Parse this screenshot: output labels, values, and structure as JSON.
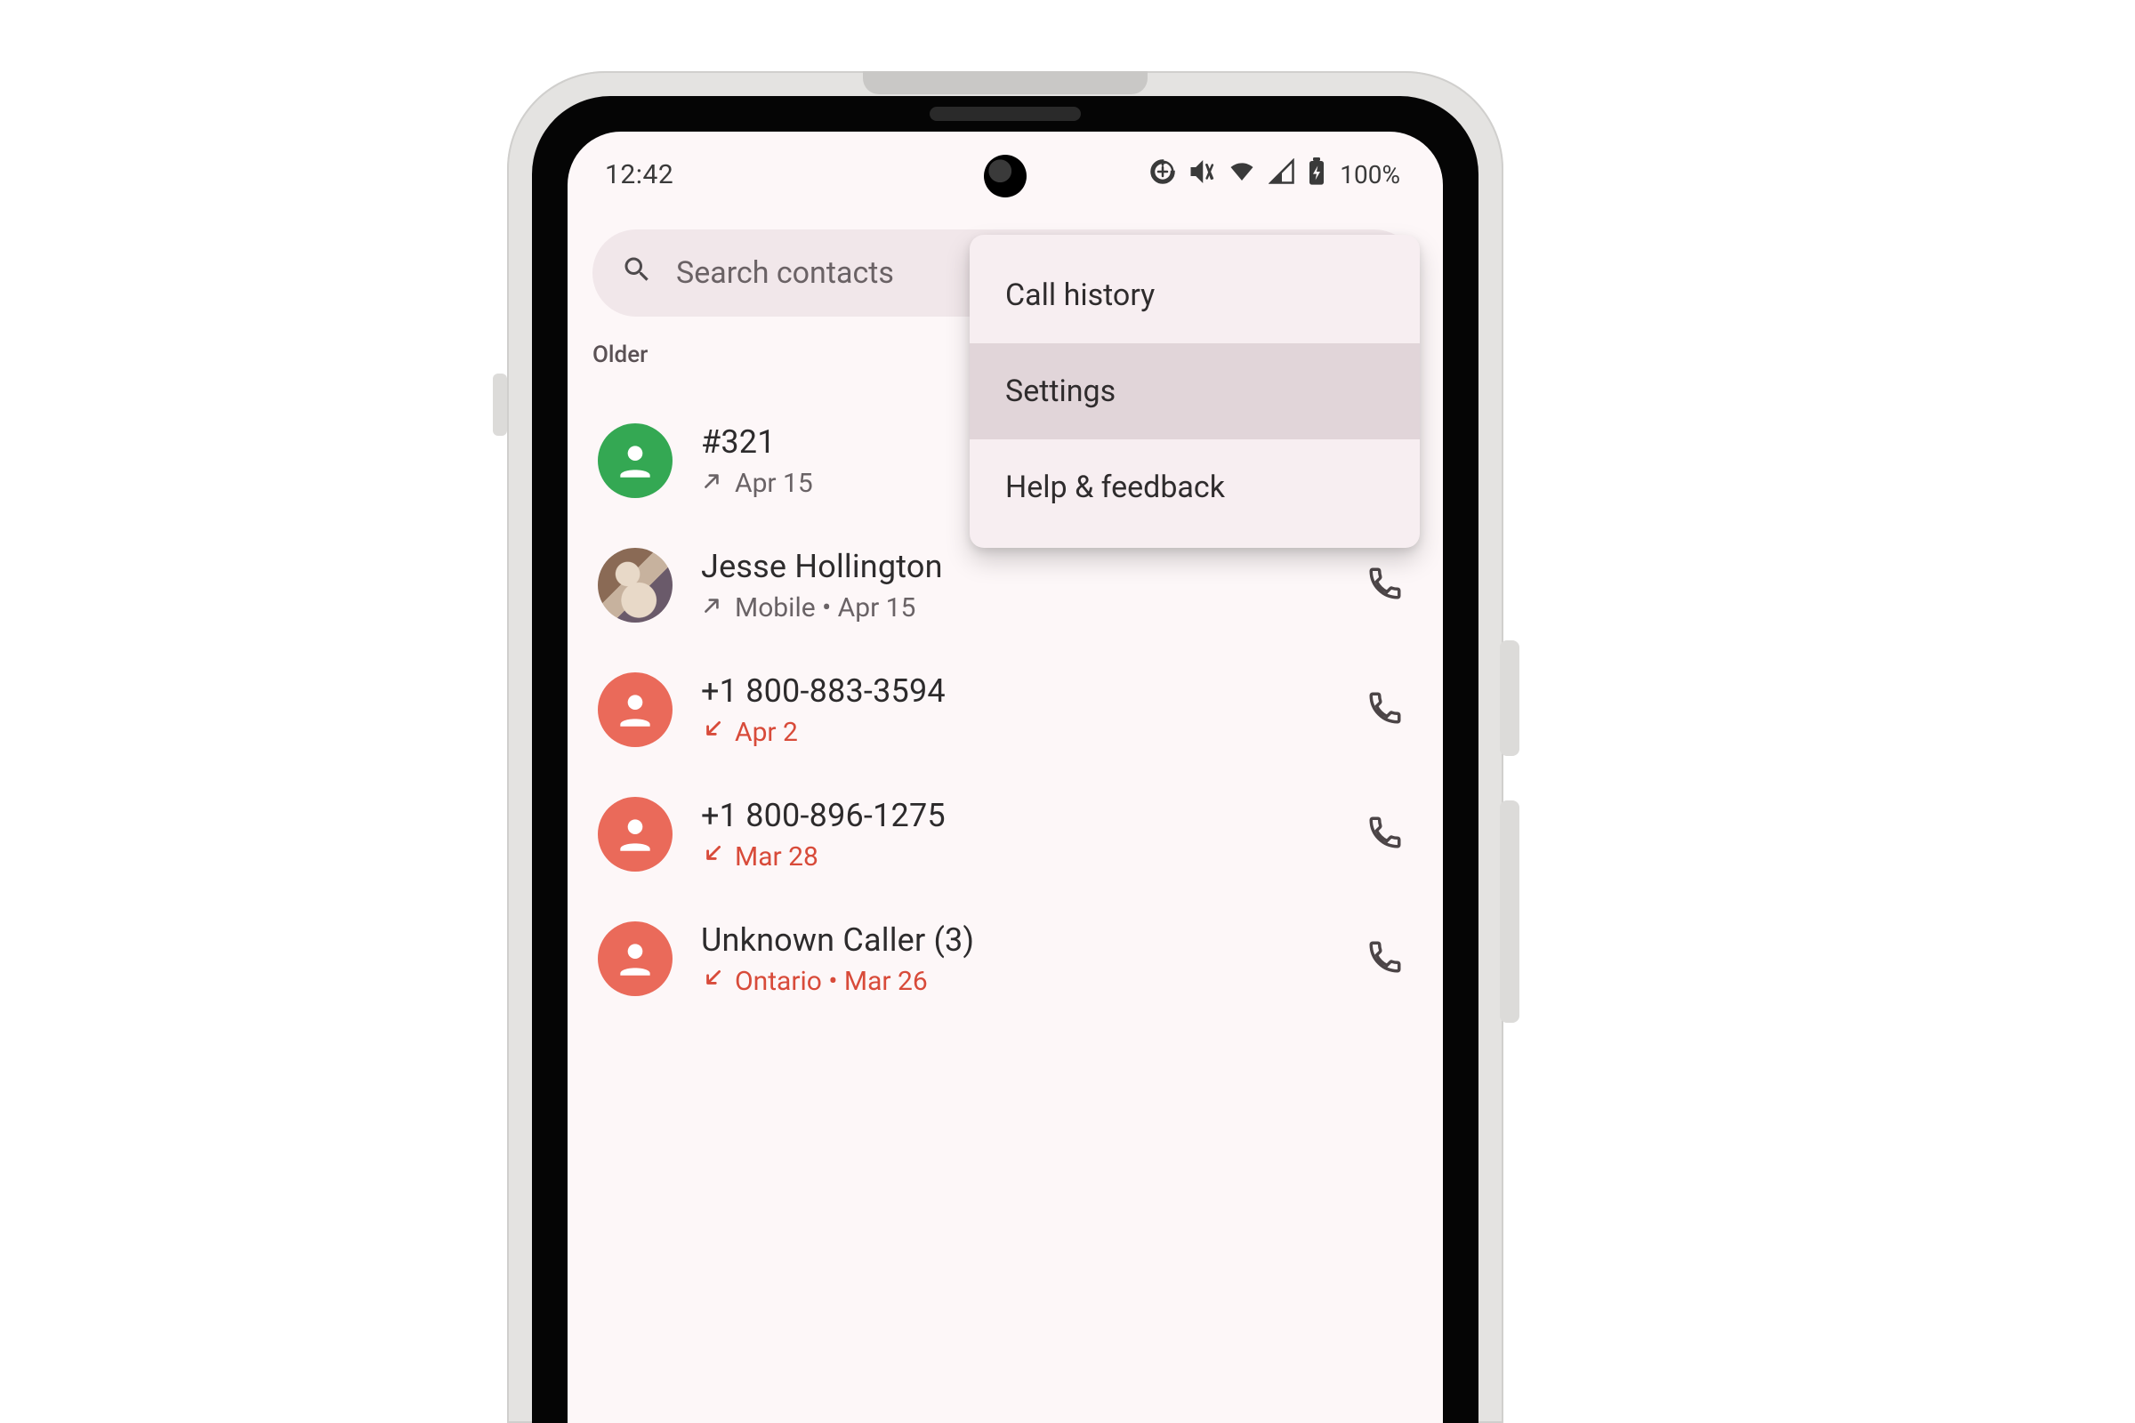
{
  "status": {
    "time": "12:42",
    "battery_pct": "100%"
  },
  "search": {
    "placeholder": "Search contacts"
  },
  "section_label": "Older",
  "menu": {
    "items": [
      {
        "label": "Call history",
        "highlight": false
      },
      {
        "label": "Settings",
        "highlight": true
      },
      {
        "label": "Help & feedback",
        "highlight": false
      }
    ]
  },
  "calls": [
    {
      "title": "#321",
      "sub": "Apr 15",
      "direction": "outgoing",
      "missed": false,
      "avatar": "green",
      "has_call": false
    },
    {
      "title": "Jesse Hollington",
      "sub": "Mobile • Apr 15",
      "direction": "outgoing",
      "missed": false,
      "avatar": "photo",
      "has_call": true
    },
    {
      "title": "+1 800-883-3594",
      "sub": "Apr 2",
      "direction": "incoming",
      "missed": true,
      "avatar": "red",
      "has_call": true
    },
    {
      "title": "+1 800-896-1275",
      "sub": "Mar 28",
      "direction": "incoming",
      "missed": true,
      "avatar": "red",
      "has_call": true
    },
    {
      "title": "Unknown Caller  (3)",
      "sub": "Ontario • Mar 26",
      "direction": "incoming",
      "missed": true,
      "avatar": "red",
      "has_call": true
    }
  ]
}
